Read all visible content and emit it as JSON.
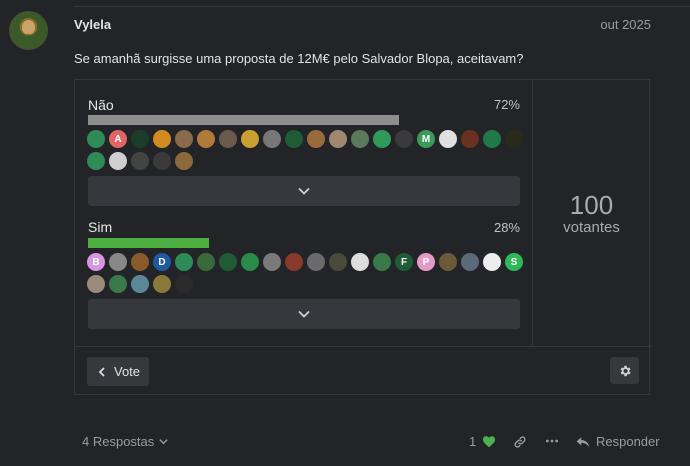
{
  "post": {
    "username": "Vylela",
    "date": "out 2025",
    "text": "Se amanhã surgisse uma proposta de 12M€ pelo Salvador Blopa, aceitavam?"
  },
  "poll": {
    "options": [
      {
        "label": "Não",
        "percent_text": "72%",
        "percent": 72,
        "bar_color": "#8e8e8e",
        "voters": [
          {
            "letter": "",
            "color": "#2e8b57"
          },
          {
            "letter": "A",
            "color": "#e06666"
          },
          {
            "letter": "",
            "color": "#1a3d2a"
          },
          {
            "letter": "",
            "color": "#d08a20"
          },
          {
            "letter": "",
            "color": "#8a6a4a"
          },
          {
            "letter": "",
            "color": "#b07a3a"
          },
          {
            "letter": "",
            "color": "#6a5a4a"
          },
          {
            "letter": "",
            "color": "#c9a030"
          },
          {
            "letter": "",
            "color": "#777777"
          },
          {
            "letter": "",
            "color": "#1f5c35"
          },
          {
            "letter": "",
            "color": "#9a6a3a"
          },
          {
            "letter": "",
            "color": "#a08870"
          },
          {
            "letter": "",
            "color": "#5a7a5a"
          },
          {
            "letter": "",
            "color": "#2f9a5a"
          },
          {
            "letter": "",
            "color": "#3a3a3a"
          },
          {
            "letter": "M",
            "color": "#3a9a5a"
          },
          {
            "letter": "",
            "color": "#e0e0e0"
          },
          {
            "letter": "",
            "color": "#6a3020"
          },
          {
            "letter": "",
            "color": "#1f7a45"
          },
          {
            "letter": "",
            "color": "#2a2a1a"
          },
          {
            "letter": "",
            "color": "#2e8b57"
          },
          {
            "letter": "",
            "color": "#cfcfcf"
          },
          {
            "letter": "",
            "color": "#444444"
          },
          {
            "letter": "",
            "color": "#3a3a3a"
          },
          {
            "letter": "",
            "color": "#8a6a3a"
          }
        ],
        "expand_icon": "chevron-down-icon"
      },
      {
        "label": "Sim",
        "percent_text": "28%",
        "percent": 28,
        "bar_color": "#4caf3f",
        "voters": [
          {
            "letter": "B",
            "color": "#d896e0"
          },
          {
            "letter": "",
            "color": "#888888"
          },
          {
            "letter": "",
            "color": "#8a5a2a"
          },
          {
            "letter": "D",
            "color": "#1f5aa0"
          },
          {
            "letter": "",
            "color": "#2e8b57"
          },
          {
            "letter": "",
            "color": "#3a6a3a"
          },
          {
            "letter": "",
            "color": "#1f5c35"
          },
          {
            "letter": "",
            "color": "#2a8a4a"
          },
          {
            "letter": "",
            "color": "#7a7a7a"
          },
          {
            "letter": "",
            "color": "#8a3a2a"
          },
          {
            "letter": "",
            "color": "#6a6a6a"
          },
          {
            "letter": "",
            "color": "#4a4a3a"
          },
          {
            "letter": "",
            "color": "#dddddd"
          },
          {
            "letter": "",
            "color": "#3a7a4a"
          },
          {
            "letter": "F",
            "color": "#1f5c35"
          },
          {
            "letter": "P",
            "color": "#e39ac8"
          },
          {
            "letter": "",
            "color": "#6a5a3a"
          },
          {
            "letter": "",
            "color": "#5a6a7a"
          },
          {
            "letter": "",
            "color": "#eeeeee"
          },
          {
            "letter": "S",
            "color": "#2fb85a"
          },
          {
            "letter": "",
            "color": "#9a8a7a"
          },
          {
            "letter": "",
            "color": "#3a7a4a"
          },
          {
            "letter": "",
            "color": "#5a8a9a"
          },
          {
            "letter": "",
            "color": "#8a7a3a"
          },
          {
            "letter": "",
            "color": "#2a2a2a"
          }
        ],
        "expand_icon": "chevron-down-icon"
      }
    ],
    "total_count": "100",
    "total_label": "votantes",
    "vote_button": "Vote",
    "settings_icon": "gear-icon"
  },
  "footer": {
    "replies": "4 Respostas",
    "like_count": "1",
    "reply_label": "Responder",
    "like_color": "#4caf50"
  }
}
